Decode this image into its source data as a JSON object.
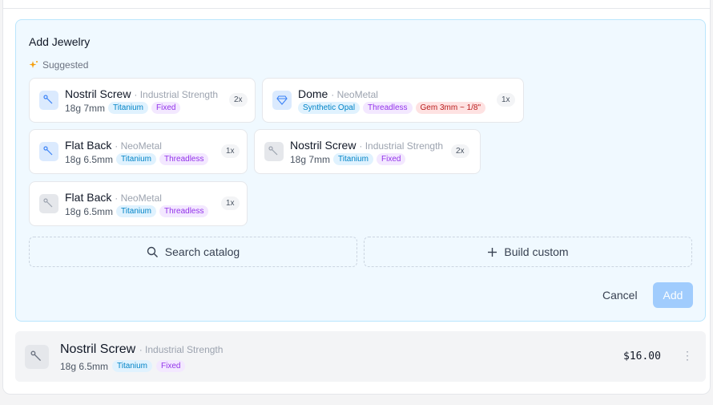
{
  "panel": {
    "title": "Add Jewelry",
    "suggested_label": "Suggested",
    "icons": {
      "sparkle": "sparkle-icon",
      "screw": "screw-icon",
      "gem": "gem-icon"
    }
  },
  "suggestions": [
    {
      "name": "Nostril Screw",
      "brand": "Industrial Strength",
      "gauge": "18g 7mm",
      "tags": [
        "Titanium",
        "Fixed"
      ],
      "qty": "2x"
    },
    {
      "name": "Dome",
      "brand": "NeoMetal",
      "gauge": "",
      "tags": [
        "Synthetic Opal",
        "Threadless",
        "Gem 3mm ~ 1/8\""
      ],
      "qty": "1x"
    },
    {
      "name": "Flat Back",
      "brand": "NeoMetal",
      "gauge": "18g 6.5mm",
      "tags": [
        "Titanium",
        "Threadless"
      ],
      "qty": "1x"
    },
    {
      "name": "Nostril Screw",
      "brand": "Industrial Strength",
      "gauge": "18g 7mm",
      "tags": [
        "Titanium",
        "Fixed"
      ],
      "qty": "2x"
    },
    {
      "name": "Flat Back",
      "brand": "NeoMetal",
      "gauge": "18g 6.5mm",
      "tags": [
        "Titanium",
        "Threadless"
      ],
      "qty": "1x"
    }
  ],
  "actions": {
    "search_label": "Search catalog",
    "build_label": "Build custom",
    "cancel_label": "Cancel",
    "add_label": "Add"
  },
  "item": {
    "name": "Nostril Screw",
    "brand": "Industrial Strength",
    "gauge": "18g 6.5mm",
    "tags": [
      "Titanium",
      "Fixed"
    ],
    "price": "$16.00"
  },
  "colors": {
    "accent": "#93c5fd",
    "panel_bg": "#f0f9ff",
    "panel_border": "#bae6fd"
  }
}
